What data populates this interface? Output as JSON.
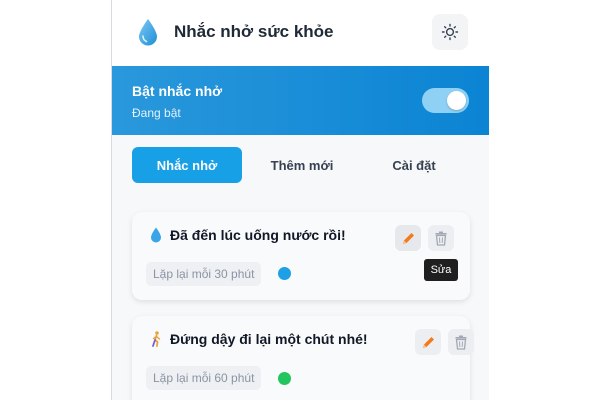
{
  "app": {
    "title": "Nhắc nhở sức khỏe",
    "icon": "water-drop-icon",
    "theme_icon": "sun-icon",
    "colors": {
      "accent": "#18a0e6",
      "banner": "#0b84d3"
    }
  },
  "banner": {
    "title": "Bật nhắc nhở",
    "subtitle": "Đang bật",
    "toggle_on": true
  },
  "tabs": [
    {
      "label": "Nhắc nhở",
      "active": true
    },
    {
      "label": "Thêm mới",
      "active": false
    },
    {
      "label": "Cài đặt",
      "active": false
    }
  ],
  "reminders": [
    {
      "icon": "water-drop-icon",
      "title": "Đã đến lúc uống nước rồi!",
      "repeat": "Lặp lại mỗi 30 phút",
      "color": "#1ea0e6"
    },
    {
      "icon": "walking-person-icon",
      "title": "Đứng dậy đi lại một chút nhé!",
      "repeat": "Lặp lại mỗi 60 phút",
      "color": "#22c55e"
    }
  ],
  "tooltip": {
    "text": "Sửa"
  }
}
